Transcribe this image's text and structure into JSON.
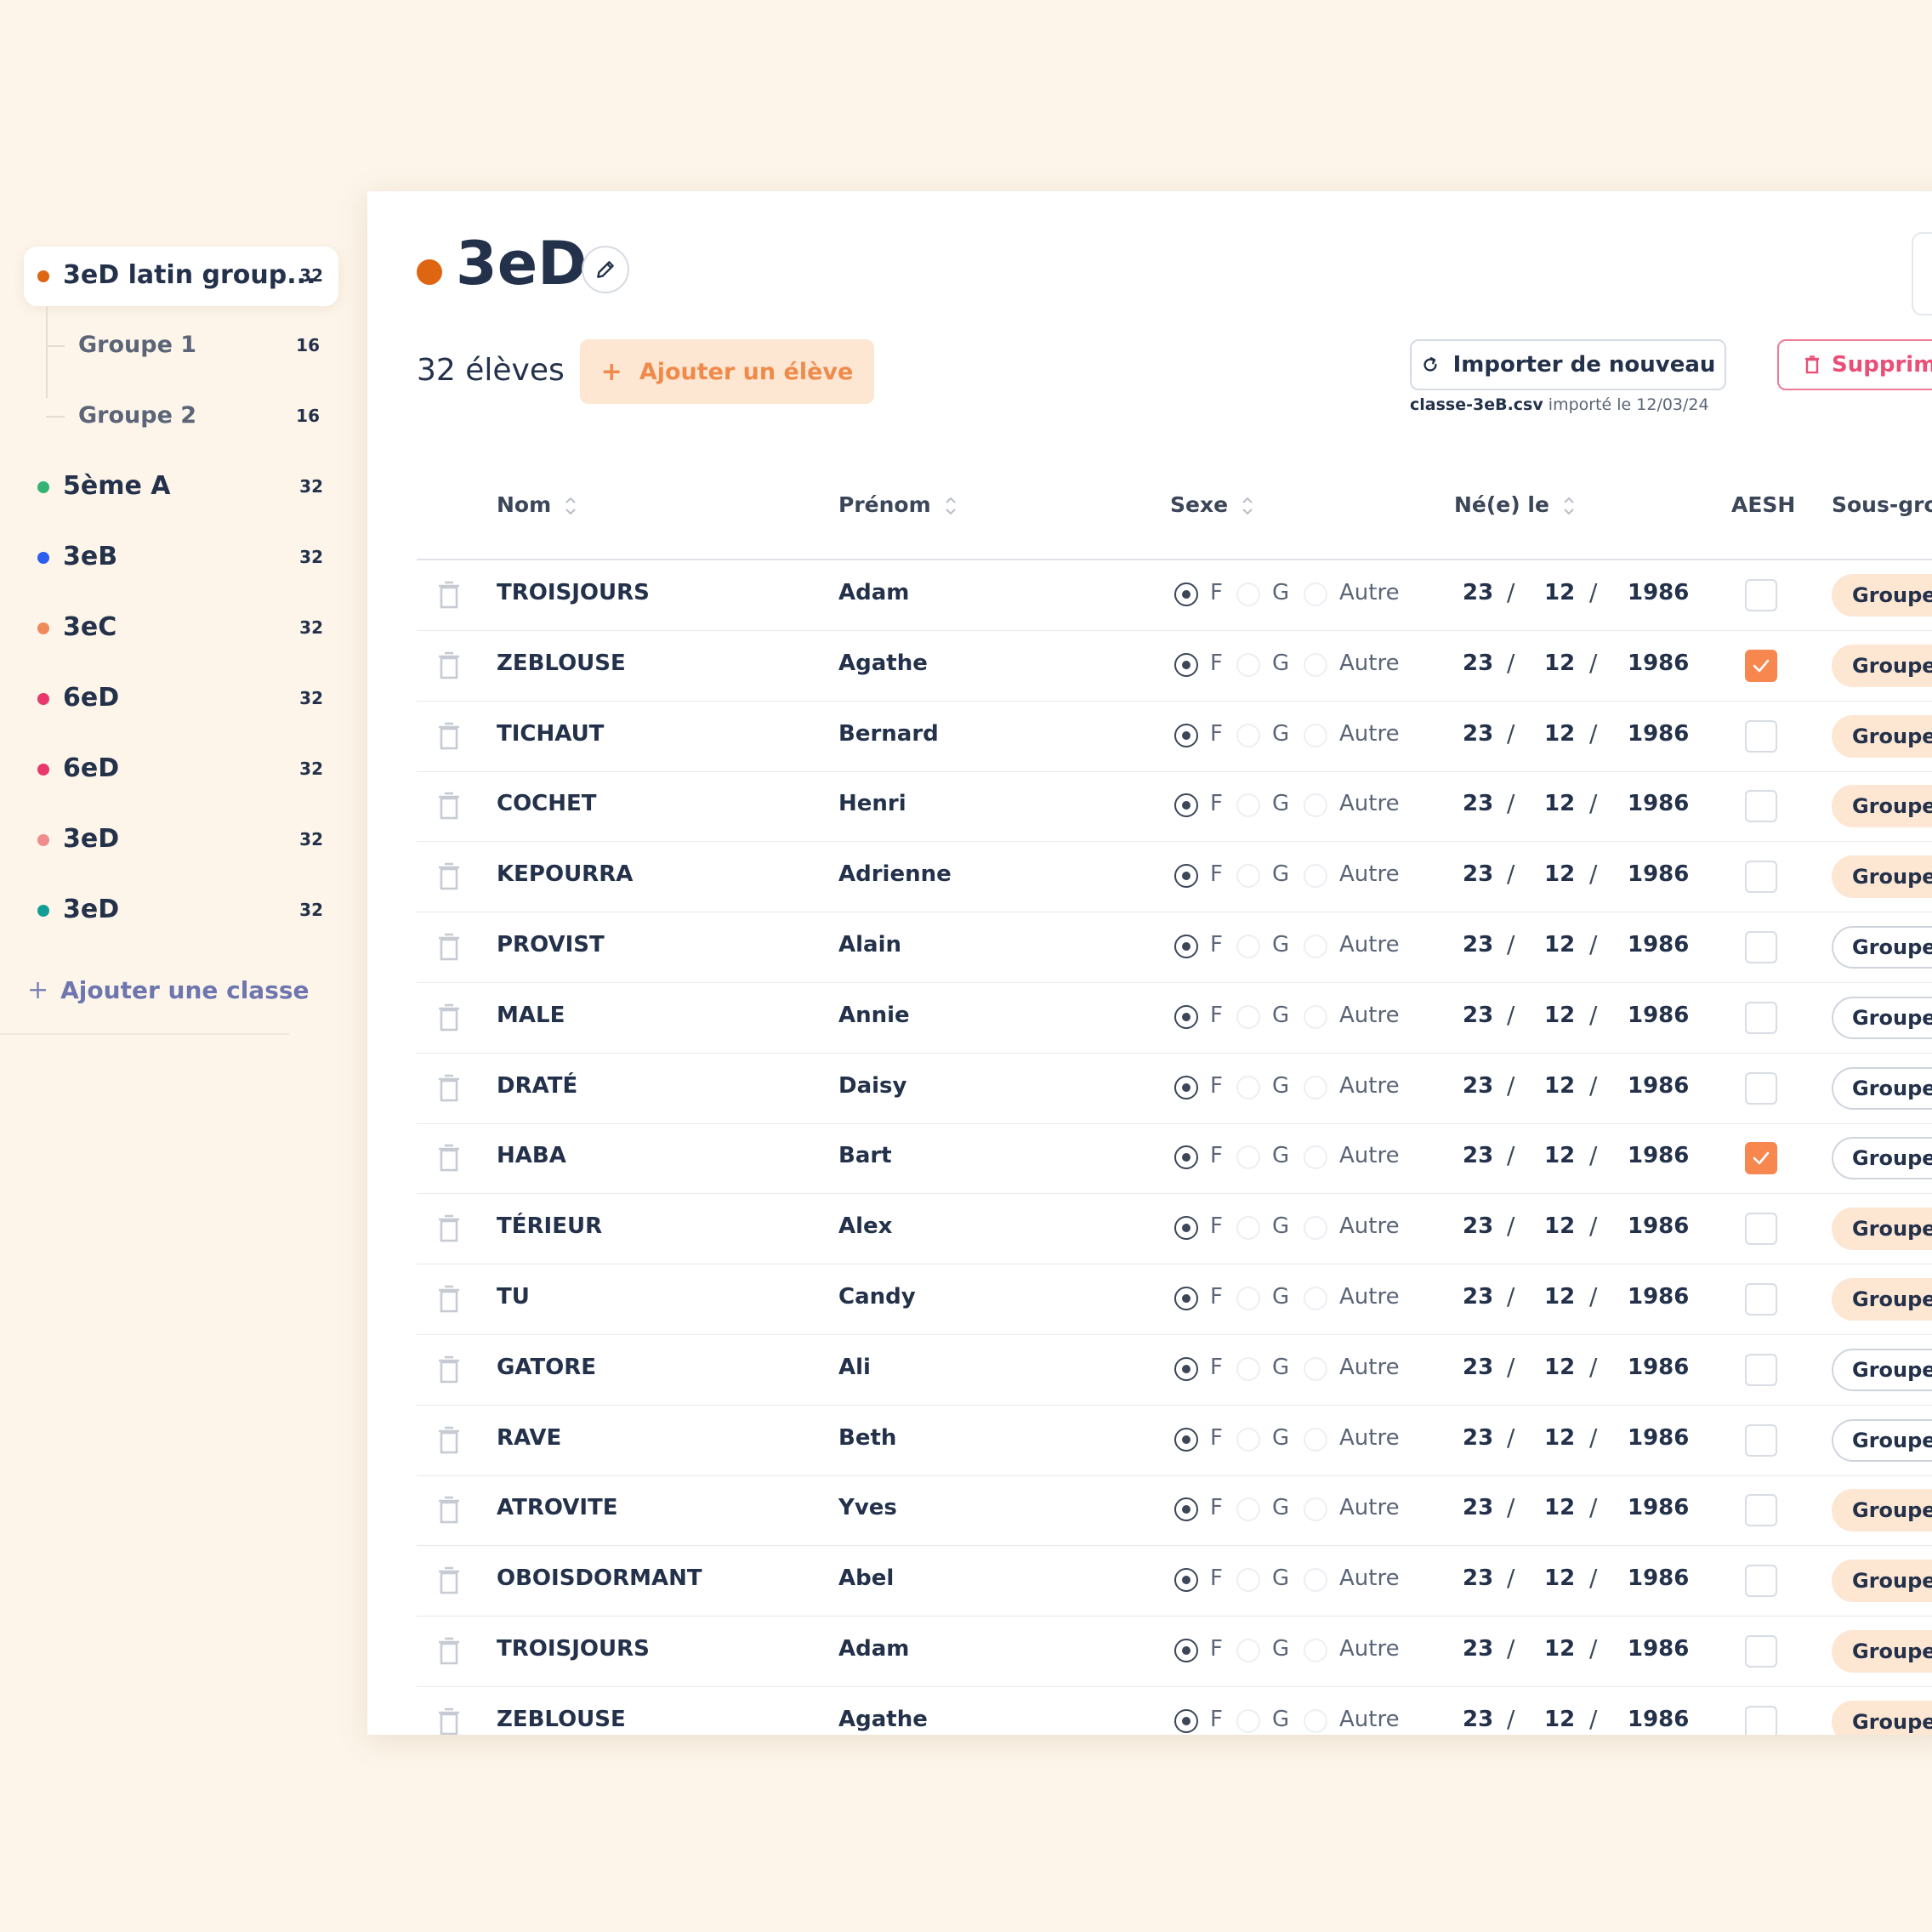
{
  "sidebar": {
    "classes": [
      {
        "name": "3eD latin group...",
        "count": "32",
        "color": "#de6512",
        "active": true
      },
      {
        "name": "5ème A",
        "count": "32",
        "color": "#35b375"
      },
      {
        "name": "3eB",
        "count": "32",
        "color": "#2c5ef0"
      },
      {
        "name": "3eC",
        "count": "32",
        "color": "#f08a5d"
      },
      {
        "name": "6eD",
        "count": "32",
        "color": "#e8386b"
      },
      {
        "name": "6eD",
        "count": "32",
        "color": "#e8386b"
      },
      {
        "name": "3eD",
        "count": "32",
        "color": "#f08c8c"
      },
      {
        "name": "3eD",
        "count": "32",
        "color": "#119e96"
      }
    ],
    "subgroups": [
      {
        "name": "Groupe 1",
        "count": "16"
      },
      {
        "name": "Groupe 2",
        "count": "16"
      }
    ],
    "add_class_label": "Ajouter une classe"
  },
  "header": {
    "class_name": "3eD",
    "class_color": "#de6512",
    "student_count_label": "32 élèves",
    "add_student_label": "Ajouter un élève",
    "import_label": "Importer de nouveau",
    "import_file": "classe-3eB.csv",
    "import_date_text": "importé le 12/03/24",
    "delete_label": "Supprim"
  },
  "table": {
    "columns": {
      "nom": "Nom",
      "prenom": "Prénom",
      "sexe": "Sexe",
      "birth": "Né(e) le",
      "aesh": "AESH",
      "subgroup": "Sous-gro"
    },
    "sex_options": [
      "F",
      "G",
      "Autre"
    ],
    "rows": [
      {
        "nom": "TROISJOURS",
        "prenom": "Adam",
        "sexe": "F",
        "day": "23",
        "month": "12",
        "year": "1986",
        "aesh": false,
        "group": "Groupe",
        "group_style": "filled"
      },
      {
        "nom": "ZEBLOUSE",
        "prenom": "Agathe",
        "sexe": "F",
        "day": "23",
        "month": "12",
        "year": "1986",
        "aesh": true,
        "group": "Groupe",
        "group_style": "filled"
      },
      {
        "nom": "TICHAUT",
        "prenom": "Bernard",
        "sexe": "F",
        "day": "23",
        "month": "12",
        "year": "1986",
        "aesh": false,
        "group": "Groupe",
        "group_style": "filled"
      },
      {
        "nom": "COCHET",
        "prenom": "Henri",
        "sexe": "F",
        "day": "23",
        "month": "12",
        "year": "1986",
        "aesh": false,
        "group": "Groupe",
        "group_style": "filled"
      },
      {
        "nom": "KEPOURRA",
        "prenom": "Adrienne",
        "sexe": "F",
        "day": "23",
        "month": "12",
        "year": "1986",
        "aesh": false,
        "group": "Groupe",
        "group_style": "filled"
      },
      {
        "nom": "PROVIST",
        "prenom": "Alain",
        "sexe": "F",
        "day": "23",
        "month": "12",
        "year": "1986",
        "aesh": false,
        "group": "Groupe",
        "group_style": "outline"
      },
      {
        "nom": "MALE",
        "prenom": "Annie",
        "sexe": "F",
        "day": "23",
        "month": "12",
        "year": "1986",
        "aesh": false,
        "group": "Groupe",
        "group_style": "outline"
      },
      {
        "nom": "DRATÉ",
        "prenom": "Daisy",
        "sexe": "F",
        "day": "23",
        "month": "12",
        "year": "1986",
        "aesh": false,
        "group": "Groupe",
        "group_style": "outline"
      },
      {
        "nom": "HABA",
        "prenom": "Bart",
        "sexe": "F",
        "day": "23",
        "month": "12",
        "year": "1986",
        "aesh": true,
        "group": "Groupe",
        "group_style": "outline"
      },
      {
        "nom": "TÉRIEUR",
        "prenom": "Alex",
        "sexe": "F",
        "day": "23",
        "month": "12",
        "year": "1986",
        "aesh": false,
        "group": "Groupe",
        "group_style": "filled"
      },
      {
        "nom": "TU",
        "prenom": "Candy",
        "sexe": "F",
        "day": "23",
        "month": "12",
        "year": "1986",
        "aesh": false,
        "group": "Groupe",
        "group_style": "filled"
      },
      {
        "nom": "GATORE",
        "prenom": "Ali",
        "sexe": "F",
        "day": "23",
        "month": "12",
        "year": "1986",
        "aesh": false,
        "group": "Groupe",
        "group_style": "outline"
      },
      {
        "nom": "RAVE",
        "prenom": "Beth",
        "sexe": "F",
        "day": "23",
        "month": "12",
        "year": "1986",
        "aesh": false,
        "group": "Groupe",
        "group_style": "outline"
      },
      {
        "nom": "ATROVITE",
        "prenom": "Yves",
        "sexe": "F",
        "day": "23",
        "month": "12",
        "year": "1986",
        "aesh": false,
        "group": "Groupe",
        "group_style": "filled"
      },
      {
        "nom": "OBOISDORMANT",
        "prenom": "Abel",
        "sexe": "F",
        "day": "23",
        "month": "12",
        "year": "1986",
        "aesh": false,
        "group": "Groupe",
        "group_style": "filled"
      },
      {
        "nom": "TROISJOURS",
        "prenom": "Adam",
        "sexe": "F",
        "day": "23",
        "month": "12",
        "year": "1986",
        "aesh": false,
        "group": "Groupe",
        "group_style": "filled"
      },
      {
        "nom": "ZEBLOUSE",
        "prenom": "Agathe",
        "sexe": "F",
        "day": "23",
        "month": "12",
        "year": "1986",
        "aesh": false,
        "group": "Groupe",
        "group_style": "filled"
      }
    ]
  }
}
